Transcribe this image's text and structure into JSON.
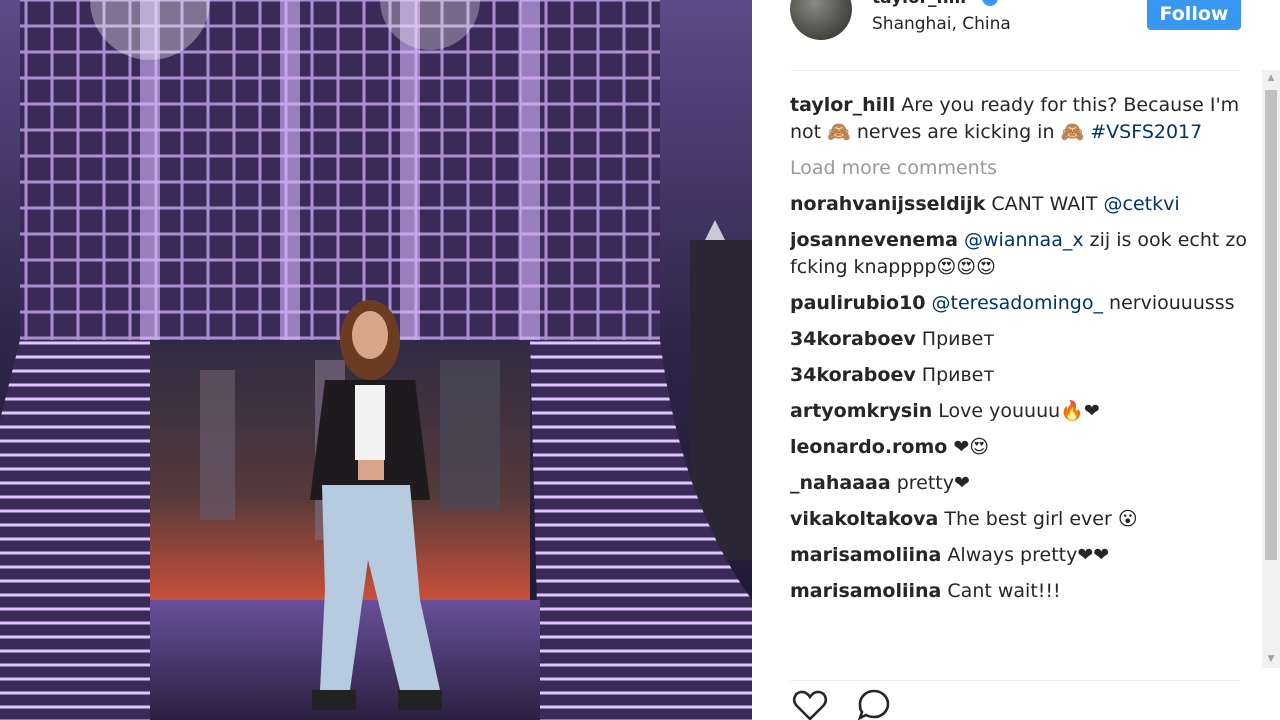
{
  "post": {
    "username": "taylor_hill",
    "location": "Shanghai, China",
    "follow_label": "Follow",
    "icons": {
      "verified": "verified-badge-icon",
      "like": "heart-icon",
      "comment": "comment-bubble-icon"
    },
    "colors": {
      "accent": "#3897f0",
      "link": "#003569",
      "muted": "#999999",
      "text": "#262626"
    }
  },
  "caption": {
    "user": "taylor_hill",
    "text": " Are you ready for this? Because I'm not 🙈 nerves are kicking in 🙈",
    "hashtag": "#VSFS2017"
  },
  "load_more_label": "Load more comments",
  "comments": [
    {
      "user": "norahvanijsseldijk",
      "before": " CANT WAIT ",
      "mention": "@cetkvi",
      "after": ""
    },
    {
      "user": "josannevenema",
      "before": " ",
      "mention": "@wiannaa_x",
      "after": " zij is ook echt zo fcking knapppp😍😍😍"
    },
    {
      "user": "paulirubio10",
      "before": " ",
      "mention": "@teresadomingo_",
      "after": " nerviouuusss"
    },
    {
      "user": "34koraboev",
      "before": " Привет",
      "mention": "",
      "after": ""
    },
    {
      "user": "34koraboev",
      "before": " Привет",
      "mention": "",
      "after": ""
    },
    {
      "user": "artyomkrysin",
      "before": " Love youuuu🔥❤",
      "mention": "",
      "after": ""
    },
    {
      "user": "leonardo.romo",
      "before": " ❤😍",
      "mention": "",
      "after": ""
    },
    {
      "user": "_nahaaaa",
      "before": " pretty❤",
      "mention": "",
      "after": ""
    },
    {
      "user": "vikakoltakova",
      "before": " The best girl ever 😮",
      "mention": "",
      "after": ""
    },
    {
      "user": "marisamoliina",
      "before": " Always pretty❤❤",
      "mention": "",
      "after": ""
    },
    {
      "user": "marisamoliina",
      "before": " Cant wait!!!",
      "mention": "",
      "after": ""
    }
  ]
}
